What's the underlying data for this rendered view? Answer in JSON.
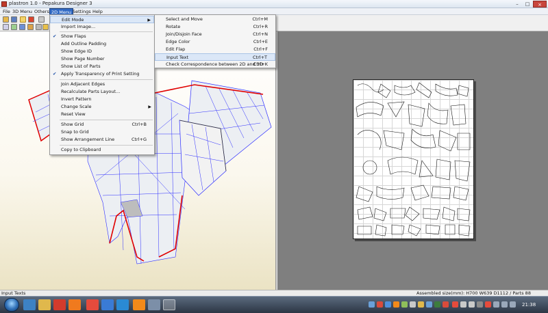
{
  "window": {
    "title": "plastron 1.0 - Pepakura Designer 3",
    "min_glyph": "–",
    "max_glyph": "□",
    "close_glyph": "×"
  },
  "menubar": {
    "items": [
      "File",
      "3D Menu",
      "Others",
      "2D Menu",
      "Settings",
      "Help"
    ],
    "active": "2D Menu"
  },
  "menu_2d": {
    "items": [
      {
        "label": "Edit Mode",
        "shortcut": "",
        "submenu": true,
        "checked": false,
        "highlighted": true
      },
      {
        "label": "Import Image...",
        "shortcut": "",
        "submenu": false,
        "checked": false
      },
      {
        "label": "Show Flaps",
        "shortcut": "",
        "submenu": false,
        "checked": true
      },
      {
        "label": "Add Outline Padding",
        "shortcut": "",
        "submenu": false,
        "checked": false
      },
      {
        "label": "Show Edge ID",
        "shortcut": "",
        "submenu": false,
        "checked": false
      },
      {
        "label": "Show Page Number",
        "shortcut": "",
        "submenu": false,
        "checked": false
      },
      {
        "label": "Show List of Parts",
        "shortcut": "",
        "submenu": false,
        "checked": false
      },
      {
        "label": "Apply Transparency of Print Setting",
        "shortcut": "",
        "submenu": false,
        "checked": true
      },
      {
        "label": "Join Adjacent Edges",
        "shortcut": "",
        "submenu": false,
        "checked": false
      },
      {
        "label": "Recalculate Parts Layout...",
        "shortcut": "",
        "submenu": false,
        "checked": false
      },
      {
        "label": "Invert Pattern",
        "shortcut": "",
        "submenu": false,
        "checked": false
      },
      {
        "label": "Change Scale",
        "shortcut": "",
        "submenu": true,
        "checked": false
      },
      {
        "label": "Reset View",
        "shortcut": "",
        "submenu": false,
        "checked": false
      },
      {
        "label": "Show Grid",
        "shortcut": "Ctrl+B",
        "submenu": false,
        "checked": false
      },
      {
        "label": "Snap to Grid",
        "shortcut": "",
        "submenu": false,
        "checked": false
      },
      {
        "label": "Show Arrangement Line",
        "shortcut": "Ctrl+G",
        "submenu": false,
        "checked": false
      },
      {
        "label": "Copy to Clipboard",
        "shortcut": "",
        "submenu": false,
        "checked": false
      }
    ]
  },
  "submenu_edit_mode": {
    "items": [
      {
        "label": "Select and Move",
        "shortcut": "Ctrl+M"
      },
      {
        "label": "Rotate",
        "shortcut": "Ctrl+R"
      },
      {
        "label": "Join/Disjoin Face",
        "shortcut": "Ctrl+N"
      },
      {
        "label": "Edge Color",
        "shortcut": "Ctrl+E"
      },
      {
        "label": "Edit Flap",
        "shortcut": "Ctrl+F"
      },
      {
        "label": "Input Text",
        "shortcut": "Ctrl+T",
        "highlighted": true
      },
      {
        "label": "Check Correspondence between 2D and 3D",
        "shortcut": "Ctrl+K"
      }
    ]
  },
  "status": {
    "left": "Input Texts",
    "right": "Assembled size(mm): H700 W639 D1112 / Parts 88"
  },
  "taskbar": {
    "clock": "21:38"
  },
  "colors": {
    "mesh_fill": "#eceff3",
    "mesh_line": "#2b2bff",
    "cut_line": "#e00000",
    "menu_highlight": "#dbe7f7",
    "view_2d_bg": "#7f7f7f"
  }
}
